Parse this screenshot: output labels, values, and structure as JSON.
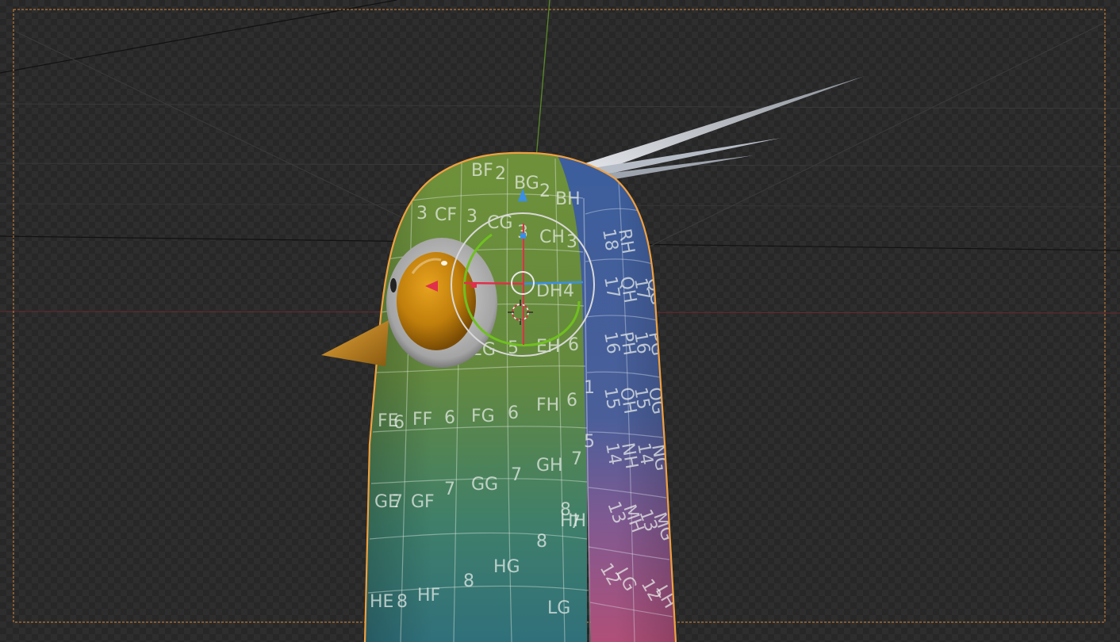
{
  "app": "3D viewport",
  "viewport": {
    "view": "camera",
    "shading": "material preview",
    "selected_object": "bird body",
    "active_tool": "transform"
  },
  "colors": {
    "background": "#2e2e2e",
    "checker": "#272727",
    "camera_frame": "#d88a3a",
    "selection_outline": "#f0a040",
    "axis_x": "#e0304a",
    "axis_y": "#70c020",
    "axis_z": "#3a8ee6",
    "body_green": "#6d8e3a",
    "body_blue": "#44619a",
    "body_teal": "#3a7a78",
    "body_pink": "#a0527a",
    "eye_amber": "#c8860e",
    "beak": "#c98a1c",
    "feather": "#c4c8d0"
  },
  "texture_labels": [
    "BF",
    "2",
    "BG",
    "2",
    "BH",
    "3",
    "CF",
    "3",
    "CG",
    "CH",
    "3",
    "3",
    "DH",
    "4",
    "5",
    "EG",
    "EH",
    "6",
    "FE",
    "6",
    "FF",
    "6",
    "FG",
    "6",
    "FH",
    "6",
    "7",
    "GE",
    "7",
    "GF",
    "7",
    "GG",
    "7",
    "GH",
    "7",
    "HH",
    "8",
    "HE",
    "8",
    "HF",
    "8",
    "HG",
    "8",
    "LG",
    "18",
    "RH",
    "17",
    "QH",
    "17",
    "QG",
    "16",
    "PH",
    "16",
    "PG",
    "15",
    "OH",
    "15",
    "OG",
    "14",
    "NH",
    "14",
    "NG",
    "13",
    "MH",
    "13",
    "MG",
    "12",
    "LG",
    "12",
    "LH",
    "1",
    "5"
  ]
}
